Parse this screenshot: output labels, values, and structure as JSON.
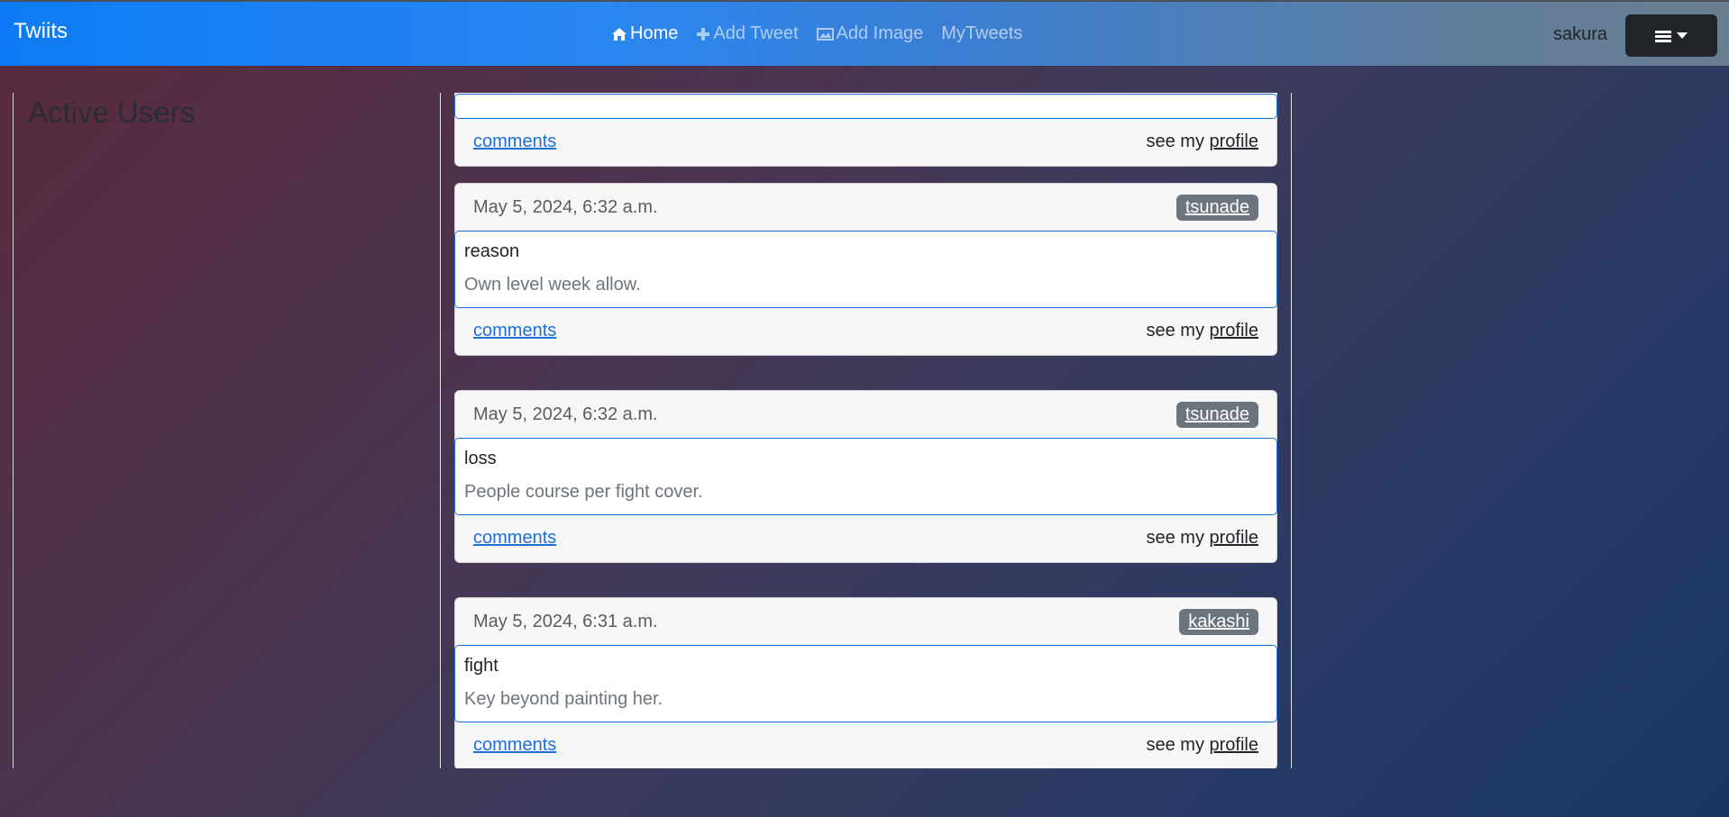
{
  "navbar": {
    "brand": "Twiits",
    "links": [
      {
        "label": "Home",
        "icon": "home-icon",
        "active": true
      },
      {
        "label": "Add Tweet",
        "icon": "plus-icon",
        "active": false
      },
      {
        "label": "Add Image",
        "icon": "image-icon",
        "active": false
      },
      {
        "label": "MyTweets",
        "icon": "",
        "active": false
      }
    ],
    "user": "sakura",
    "menu_icon": "hamburger-icon"
  },
  "sidebar": {
    "title": "Active Users"
  },
  "feed": {
    "comments_label": "comments",
    "see_my_label": "see my",
    "profile_label": "profile",
    "tweets": [
      {
        "date": "May 5, 2024, 6:32 a.m.",
        "author": "tsunade",
        "title": "reason",
        "text": "Own level week allow."
      },
      {
        "date": "May 5, 2024, 6:32 a.m.",
        "author": "tsunade",
        "title": "loss",
        "text": "People course per fight cover."
      },
      {
        "date": "May 5, 2024, 6:31 a.m.",
        "author": "kakashi",
        "title": "fight",
        "text": "Key beyond painting her."
      }
    ]
  },
  "colors": {
    "accent": "#1f6fd8",
    "badge": "#6c757d",
    "navbar_start": "#0d7bf5"
  }
}
